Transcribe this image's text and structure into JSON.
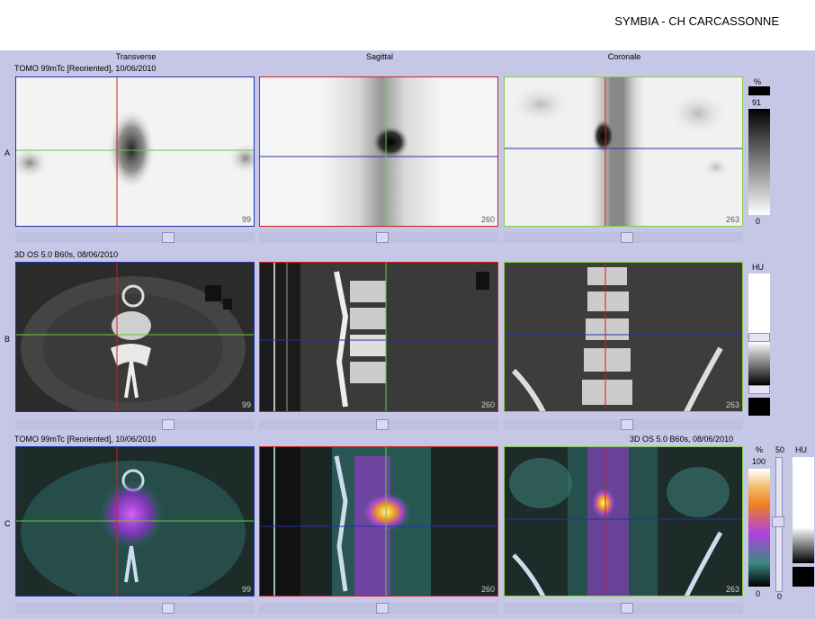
{
  "header": {
    "title": "SYMBIA - CH CARCASSONNE"
  },
  "columns": {
    "transverse": "Transverse",
    "sagittal": "Sagittal",
    "coronal": "Coronale"
  },
  "rows": {
    "a": {
      "letter": "A",
      "series": "TOMO 99mTc [Reoriented], 10/06/2010"
    },
    "b": {
      "letter": "B",
      "series": "3D  OS  5.0  B60s, 08/06/2010"
    },
    "c": {
      "letter": "C",
      "series_left": "TOMO 99mTc [Reoriented], 10/06/2010",
      "series_right": "3D  OS  5.0  B60s, 08/06/2010"
    }
  },
  "slices": {
    "transverse": "99",
    "sagittal": "260",
    "coronal": "263"
  },
  "scale_a": {
    "unit": "%",
    "max": "91",
    "min": "0"
  },
  "scale_b": {
    "unit": "HU"
  },
  "scale_c": {
    "unit_pct": "%",
    "max": "100",
    "min": "0",
    "blend": "50",
    "blend_min": "0",
    "unit_hu": "HU"
  },
  "colors": {
    "transverse_frame": "#2233aa",
    "sagittal_frame": "#cc2222",
    "coronal_frame": "#88cc44"
  }
}
